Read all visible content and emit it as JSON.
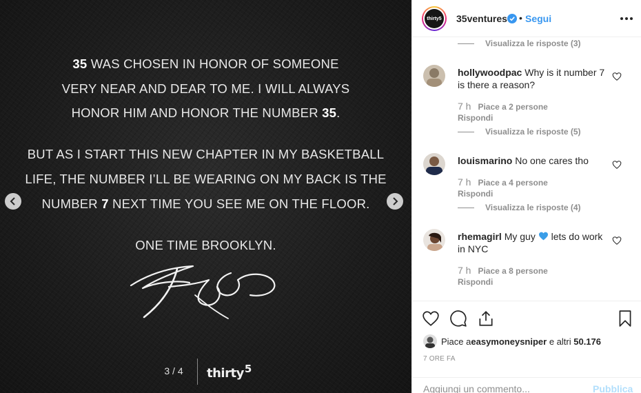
{
  "post_image": {
    "lines": [
      {
        "bold_start": "35",
        "rest": " WAS CHOSEN IN HONOR OF SOMEONE"
      },
      {
        "text": "VERY NEAR AND DEAR TO ME. I WILL ALWAYS"
      },
      {
        "pre": "HONOR HIM AND HONOR THE NUMBER ",
        "bold": "35",
        "post": "."
      },
      {
        "text": "BUT AS I START THIS NEW CHAPTER IN MY BASKETBALL"
      },
      {
        "text": "LIFE, THE NUMBER I’LL BE WEARING ON MY BACK IS THE"
      },
      {
        "pre": "NUMBER ",
        "bold": "7",
        "post": " NEXT TIME YOU SEE ME ON THE FLOOR."
      },
      {
        "text": "ONE TIME BROOKLYN."
      }
    ],
    "pager": "3 / 4",
    "brand_word": "thirty",
    "brand_num": "5",
    "signature_label": "KD"
  },
  "header": {
    "avatar_text": "thirty5",
    "username": "35ventures",
    "separator": "•",
    "follow_label": "Segui"
  },
  "comments": {
    "top_reply_toggle": "Visualizza le risposte (3)",
    "items": [
      {
        "user": "hollywoodpac",
        "text": "Why is it number 7 is there a reason?",
        "time": "7 h",
        "likes": "Piace a 2 persone",
        "reply": "Rispondi",
        "replies_toggle": "Visualizza le risposte (5)"
      },
      {
        "user": "louismarino",
        "text": "No one cares tho",
        "time": "7 h",
        "likes": "Piace a 4 persone",
        "reply": "Rispondi",
        "replies_toggle": "Visualizza le risposte (4)"
      },
      {
        "user": "rhemagirl",
        "text_before": "My guy ",
        "text_after": " lets do work in NYC",
        "time": "7 h",
        "likes": "Piace a 8 persone",
        "reply": "Rispondi"
      }
    ]
  },
  "actions": {
    "likes_prefix": "Piace a ",
    "likes_user": "easymoneysniper",
    "likes_middle": " e altri ",
    "likes_count": "50.176",
    "post_time": "7 ORE FA",
    "comment_placeholder": "Aggiungi un commento...",
    "publish_label": "Pubblica"
  },
  "colors": {
    "link_blue": "#3897f0",
    "publish_disabled": "#b2dffc",
    "heart_blue": "#3897f0",
    "muted_gray": "#8e8e8e"
  }
}
